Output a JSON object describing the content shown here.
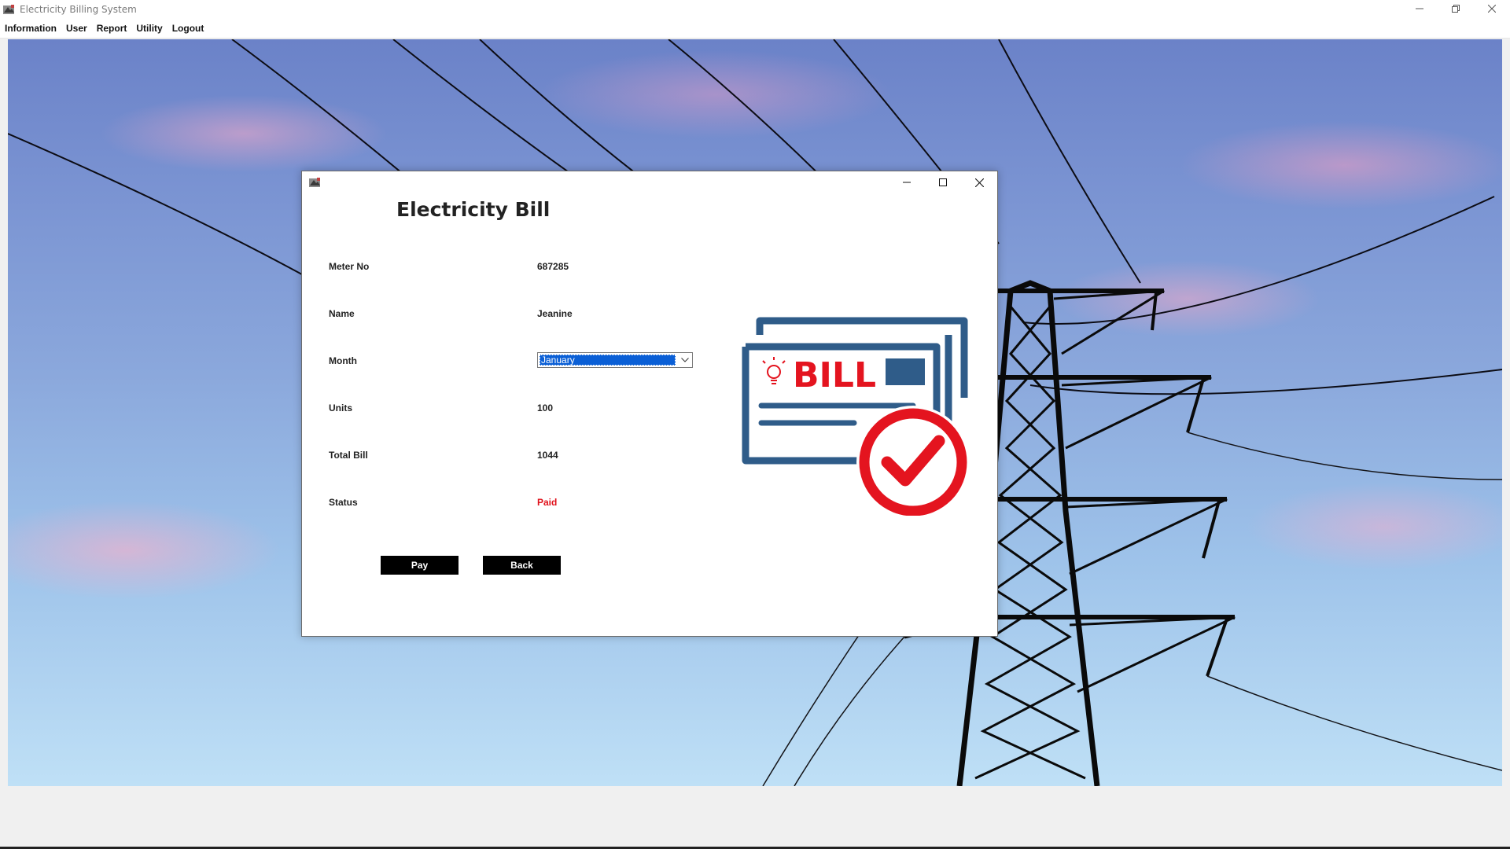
{
  "window": {
    "title": "Electricity Billing System"
  },
  "menu": {
    "items": [
      "Information",
      "User",
      "Report",
      "Utility",
      "Logout"
    ]
  },
  "dialog": {
    "title": "Electricity Bill",
    "fields": {
      "meter_label": "Meter No",
      "meter_value": "687285",
      "name_label": "Name",
      "name_value": "Jeanine",
      "month_label": "Month",
      "month_value": "January",
      "units_label": "Units",
      "units_value": "100",
      "total_label": "Total Bill",
      "total_value": "1044",
      "status_label": "Status",
      "status_value": "Paid"
    },
    "buttons": {
      "pay": "Pay",
      "back": "Back"
    },
    "graphic": {
      "text": "BILL"
    }
  },
  "colors": {
    "status_paid": "#e0101a",
    "button_bg": "#000000",
    "select_highlight": "#0a5fd6",
    "bill_blue": "#2f5c89",
    "bill_red": "#e4141f"
  },
  "icons": {
    "app": "app-icon",
    "minimize": "minimize-icon",
    "maximize": "maximize-icon",
    "restore": "restore-icon",
    "close": "close-icon",
    "dropdown": "chevron-down-icon",
    "bulb": "bulb-icon",
    "check": "check-circle-icon"
  }
}
